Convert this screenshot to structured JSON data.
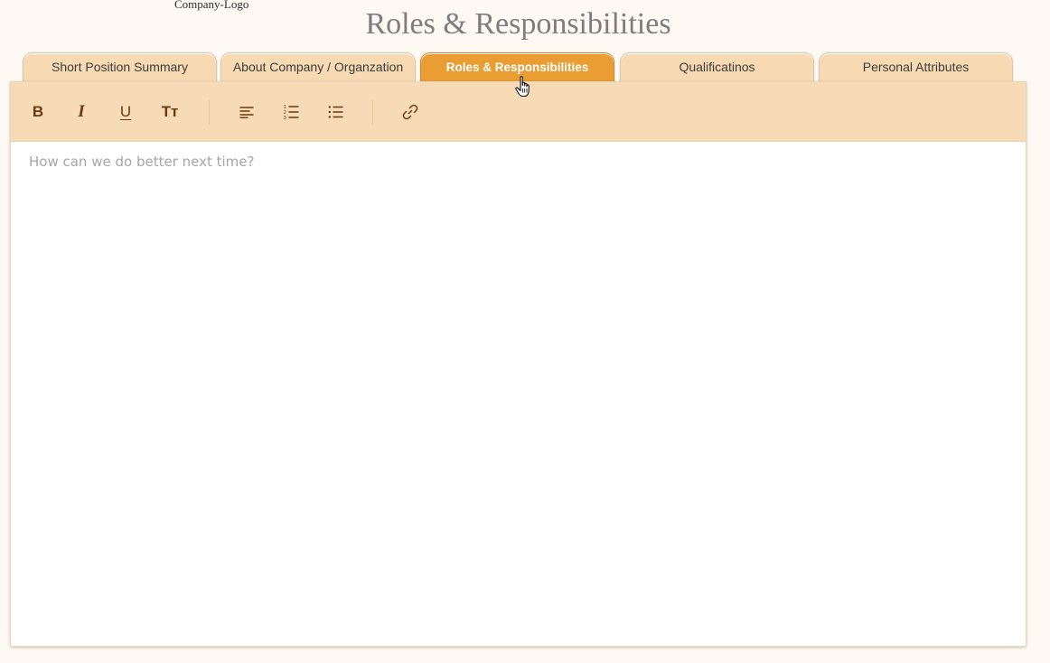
{
  "header": {
    "logo_text": "Company-Logo",
    "title": "Roles & Responsibilities"
  },
  "tabs": [
    {
      "label": "Short Position Summary",
      "active": false
    },
    {
      "label": "About Company / Organzation",
      "active": false
    },
    {
      "label": "Roles & Responsibilities",
      "active": true
    },
    {
      "label": "Qualificatinos",
      "active": false
    },
    {
      "label": "Personal Attributes",
      "active": false
    }
  ],
  "toolbar": {
    "bold_label": "B",
    "italic_label": "I",
    "underline_label": "U",
    "text_size_label": "Tт",
    "icons": [
      "align-left-icon",
      "ordered-list-icon",
      "bullet-list-icon",
      "link-icon"
    ]
  },
  "editor": {
    "value": "",
    "placeholder": "How can we do better next time?"
  },
  "colors": {
    "page_background": "#fefaf3",
    "tab_background": "#f7d9b2",
    "tab_active_background": "#e99d33",
    "toolbar_background": "#f7dbb6",
    "toolbar_icon": "#6a3a12",
    "title_color": "#7d7d7d"
  }
}
